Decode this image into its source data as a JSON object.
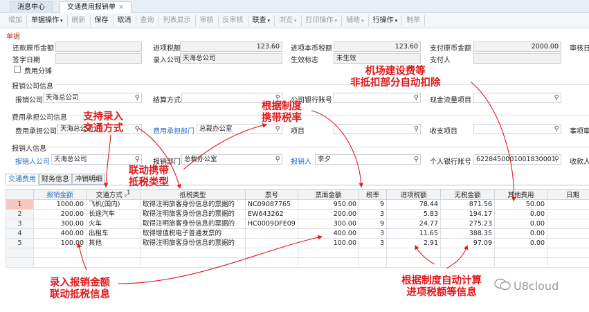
{
  "tabs": [
    {
      "label": "消息中心"
    },
    {
      "label": "交通费用报销单",
      "close": "×"
    }
  ],
  "toolbar": [
    {
      "label": "增加",
      "enabled": false
    },
    {
      "label": "单据操作",
      "enabled": true,
      "dropdown": true
    },
    {
      "label": "刷新",
      "enabled": false
    },
    {
      "label": "保存",
      "enabled": true
    },
    {
      "label": "取消",
      "enabled": true
    },
    {
      "label": "查询",
      "enabled": false
    },
    {
      "label": "列表显示",
      "enabled": false
    },
    {
      "label": "审核",
      "enabled": false
    },
    {
      "label": "反审核",
      "enabled": false
    },
    {
      "label": "联查",
      "enabled": true,
      "dropdown": true
    },
    {
      "label": "浏览",
      "enabled": false,
      "dropdown": true
    },
    {
      "label": "打印操作",
      "enabled": false,
      "dropdown": true
    },
    {
      "label": "辅助",
      "enabled": false,
      "dropdown": true
    },
    {
      "label": "行操作",
      "enabled": true,
      "dropdown": true
    },
    {
      "label": "制单",
      "enabled": false
    }
  ],
  "section_title": "单据",
  "form": {
    "repay_amount": {
      "label": "还款原币金额",
      "value": ""
    },
    "input_tax": {
      "label": "进项税额",
      "value": "123.60"
    },
    "input_tax_local": {
      "label": "进项本币税额",
      "value": "123.60"
    },
    "pay_amount": {
      "label": "支付原币金额",
      "value": "2000.00"
    },
    "auditor": {
      "label": "审核日"
    },
    "sign_date": {
      "label": "签字日期",
      "value": ""
    },
    "entry_company": {
      "label": "录入公司",
      "value": "天海总公司"
    },
    "effect_flag": {
      "label": "生效标志",
      "value": "未生效"
    },
    "payer": {
      "label": "支付人",
      "value": ""
    },
    "cost_split": {
      "label": "费用分摊",
      "checked": false
    }
  },
  "groups": {
    "reimb_company": {
      "title": "报销公司信息",
      "company": {
        "label": "报销公司",
        "value": "天海总公司"
      },
      "settle": {
        "label": "结算方式",
        "value": ""
      },
      "bank": {
        "label": "公司银行账号",
        "value": ""
      },
      "cashflow": {
        "label": "现金流量项目",
        "value": ""
      }
    },
    "cost_company": {
      "title": "费用承担公司信息",
      "company": {
        "label": "费用承担公司",
        "value": "天海总公司"
      },
      "dept": {
        "label": "费用承担部门",
        "value": "总裁办公室"
      },
      "project": {
        "label": "项目",
        "value": ""
      },
      "income": {
        "label": "收支项目",
        "value": ""
      },
      "matter": {
        "label": "事项审"
      }
    },
    "reimburser": {
      "title": "报销人信息",
      "company": {
        "label": "报销人公司",
        "value": "天海总公司"
      },
      "dept": {
        "label": "报销部门",
        "value": "总裁办公室"
      },
      "person": {
        "label": "报销人",
        "value": "李夕"
      },
      "bank": {
        "label": "个人银行账号",
        "value": "6228450001001830001"
      },
      "payee": {
        "label": "收款人"
      }
    }
  },
  "bottom_tabs": [
    "交通费用",
    "财务信息",
    "冲销明细"
  ],
  "table": {
    "headers": [
      "报销金额",
      "交通方式",
      "抵税类型",
      "票号",
      "票面金额",
      "税率",
      "进项税额",
      "无税金额",
      "其他费用",
      "日期"
    ],
    "sort_hint": "1",
    "rows": [
      {
        "idx": "1",
        "amount": "1000.00",
        "mode": "飞机(国内)",
        "tax_type": "取得注明旅客身份信息的票据的",
        "ticket": "NC09087765",
        "face": "950.00",
        "rate": "9",
        "input_tax": "78.44",
        "untaxed": "871.56",
        "other": "50.00",
        "date": ""
      },
      {
        "idx": "2",
        "amount": "200.00",
        "mode": "长途汽车",
        "tax_type": "取得注明旅客身份信息的票据的",
        "ticket": "EW643262",
        "face": "200.00",
        "rate": "3",
        "input_tax": "5.83",
        "untaxed": "194.17",
        "other": "0.00",
        "date": ""
      },
      {
        "idx": "3",
        "amount": "300.00",
        "mode": "火车",
        "tax_type": "取得注明旅客身份信息的票据的",
        "ticket": "HC0009DFE09",
        "face": "300.00",
        "rate": "9",
        "input_tax": "24.77",
        "untaxed": "275.23",
        "other": "0.00",
        "date": ""
      },
      {
        "idx": "4",
        "amount": "400.00",
        "mode": "出租车",
        "tax_type": "取得增值税电子普通发票的",
        "ticket": "",
        "face": "400.00",
        "rate": "3",
        "input_tax": "11.65",
        "untaxed": "388.35",
        "other": "0.00",
        "date": ""
      },
      {
        "idx": "5",
        "amount": "100.00",
        "mode": "其他",
        "tax_type": "取得注明旅客身份信息的票据的",
        "ticket": "",
        "face": "100.00",
        "rate": "3",
        "input_tax": "2.91",
        "untaxed": "97.09",
        "other": "0.00",
        "date": ""
      }
    ]
  },
  "annotations": {
    "transport": [
      "支持录入",
      "交通方式"
    ],
    "linkage": [
      "联动携带",
      "抵税类型"
    ],
    "rate": [
      "根据制度",
      "携带税率"
    ],
    "airport": [
      "机场建设费等",
      "非抵扣部分自动扣除"
    ],
    "amount": [
      "录入报销金额",
      "联动抵税信息"
    ],
    "auto": [
      "根据制度自动计算",
      "进项税额等信息"
    ]
  },
  "watermark": "U8cloud",
  "colors": {
    "annotation": "#e0181a",
    "link_blue": "#2a6fc9",
    "selected_row": "#f7c7bd"
  }
}
